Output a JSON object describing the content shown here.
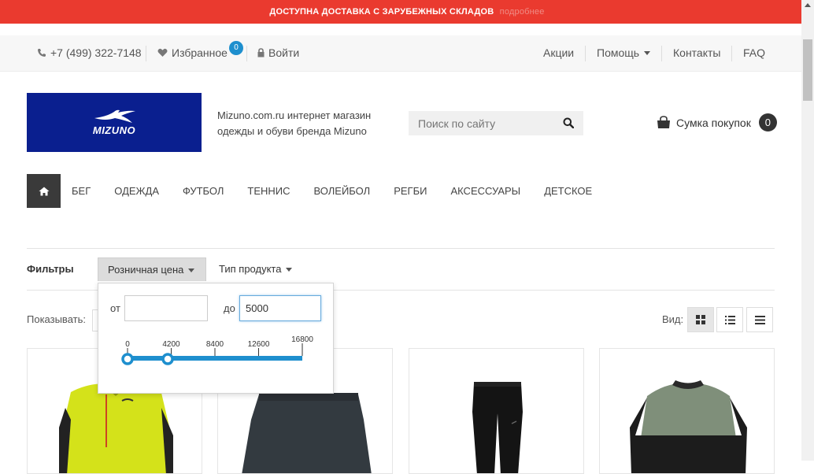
{
  "announcement": {
    "text": "ДОСТУПНА ДОСТАВКА С ЗАРУБЕЖНЫХ СКЛАДОВ",
    "link": "подробнее"
  },
  "infobar": {
    "phone": "+7 (499) 322-7148",
    "favorites": "Избранное",
    "favorites_count": "0",
    "login": "Войти",
    "links": [
      "Акции",
      "Помощь",
      "Контакты",
      "FAQ"
    ]
  },
  "header": {
    "logo_text": "MIZUNO",
    "tagline": "Mizuno.com.ru интернет магазин одежды и обуви бренда Mizuno",
    "search_placeholder": "Поиск по сайту",
    "cart_label": "Сумка покупок",
    "cart_count": "0"
  },
  "nav": {
    "items": [
      "БЕГ",
      "ОДЕЖДА",
      "ФУТБОЛ",
      "ТЕННИС",
      "ВОЛЕЙБОЛ",
      "РЕГБИ",
      "АКСЕССУАРЫ",
      "ДЕТСКОЕ"
    ]
  },
  "filters": {
    "label": "Фильтры",
    "tabs": [
      "Розничная цена",
      "Тип продукта"
    ],
    "price": {
      "from_label": "от",
      "to_label": "до",
      "from_value": "",
      "to_value": "5000",
      "ticks": [
        "0",
        "4200",
        "8400",
        "12600",
        "16800"
      ],
      "min": 0,
      "max": 16800,
      "handle_low": 0,
      "handle_high": 5000
    }
  },
  "listing": {
    "show_label": "Показывать:",
    "view_label": "Вид:"
  },
  "colors": {
    "announcement": "#ea3a2f",
    "accent": "#1e8fce",
    "logo_bg": "#0a1f8f"
  }
}
